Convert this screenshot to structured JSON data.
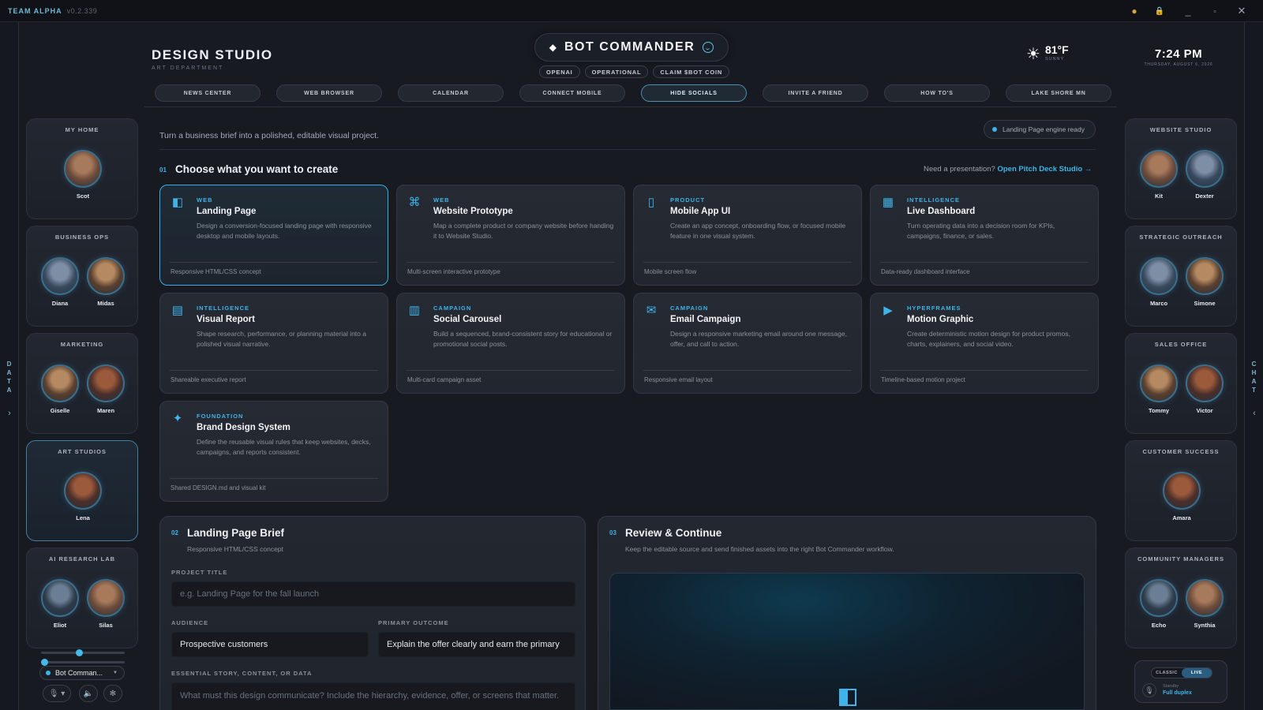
{
  "titlebar": {
    "brand": "TEAM ALPHA",
    "version": "v0.2.339"
  },
  "edges": {
    "left_label": "D\nA\nT\nA",
    "right_label": "C\nH\nA\nT",
    "left_arrow": "›",
    "right_arrow": "‹"
  },
  "header": {
    "title": "DESIGN STUDIO",
    "subtitle": "ART DEPARTMENT",
    "app_name": "BOT COMMANDER",
    "pills": [
      "OPENAI",
      "OPERATIONAL",
      "CLAIM $BOT COIN"
    ],
    "temperature": "81°F",
    "condition": "SUNNY",
    "time": "7:24 PM",
    "date": "THURSDAY, AUGUST 6, 2026"
  },
  "nav": [
    "NEWS CENTER",
    "WEB BROWSER",
    "CALENDAR",
    "CONNECT MOBILE",
    "HIDE SOCIALS",
    "INVITE A FRIEND",
    "HOW TO'S",
    "LAKE SHORE MN"
  ],
  "nav_active": "HIDE SOCIALS",
  "left_teams": [
    {
      "title": "MY HOME",
      "members": [
        "Scot"
      ]
    },
    {
      "title": "BUSINESS OPS",
      "members": [
        "Diana",
        "Midas"
      ]
    },
    {
      "title": "MARKETING",
      "members": [
        "Giselle",
        "Maren"
      ]
    },
    {
      "title": "ART STUDIOS",
      "members": [
        "Lena"
      ]
    },
    {
      "title": "AI RESEARCH LAB",
      "members": [
        "Eliot",
        "Silas"
      ]
    }
  ],
  "right_teams": [
    {
      "title": "WEBSITE STUDIO",
      "members": [
        "Kit",
        "Dexter"
      ]
    },
    {
      "title": "STRATEGIC OUTREACH",
      "members": [
        "Marco",
        "Simone"
      ]
    },
    {
      "title": "SALES OFFICE",
      "members": [
        "Tommy",
        "Victor"
      ]
    },
    {
      "title": "CUSTOMER SUCCESS",
      "members": [
        "Amara"
      ]
    },
    {
      "title": "COMMUNITY MANAGERS",
      "members": [
        "Echo",
        "Synthia"
      ]
    }
  ],
  "bot_selector": "Bot Comman...",
  "main": {
    "tagline": "Turn a business brief into a polished, editable visual project.",
    "engine_status": "Landing Page engine ready",
    "step1": {
      "no": "01",
      "title": "Choose what you want to create"
    },
    "need_text": "Need a presentation?",
    "need_link": "Open Pitch Deck Studio →",
    "cards": [
      {
        "cat": "WEB",
        "title": "Landing Page",
        "desc": "Design a conversion-focused landing page with responsive desktop and mobile layouts.",
        "foot": "Responsive HTML/CSS concept",
        "icon": "◧",
        "icon_name": "layout-icon"
      },
      {
        "cat": "WEB",
        "title": "Website Prototype",
        "desc": "Map a complete product or company website before handing it to Website Studio.",
        "foot": "Multi-screen interactive prototype",
        "icon": "⌘",
        "icon_name": "command-icon"
      },
      {
        "cat": "PRODUCT",
        "title": "Mobile App UI",
        "desc": "Create an app concept, onboarding flow, or focused mobile feature in one visual system.",
        "foot": "Mobile screen flow",
        "icon": "▯",
        "icon_name": "phone-icon"
      },
      {
        "cat": "INTELLIGENCE",
        "title": "Live Dashboard",
        "desc": "Turn operating data into a decision room for KPIs, campaigns, finance, or sales.",
        "foot": "Data-ready dashboard interface",
        "icon": "▦",
        "icon_name": "grid-icon"
      },
      {
        "cat": "INTELLIGENCE",
        "title": "Visual Report",
        "desc": "Shape research, performance, or planning material into a polished visual narrative.",
        "foot": "Shareable executive report",
        "icon": "▤",
        "icon_name": "report-icon"
      },
      {
        "cat": "CAMPAIGN",
        "title": "Social Carousel",
        "desc": "Build a sequenced, brand-consistent story for educational or promotional social posts.",
        "foot": "Multi-card campaign asset",
        "icon": "▥",
        "icon_name": "carousel-icon"
      },
      {
        "cat": "CAMPAIGN",
        "title": "Email Campaign",
        "desc": "Design a responsive marketing email around one message, offer, and call to action.",
        "foot": "Responsive email layout",
        "icon": "✉",
        "icon_name": "mail-icon"
      },
      {
        "cat": "HYPERFRAMES",
        "title": "Motion Graphic",
        "desc": "Create deterministic motion design for product promos, charts, explainers, and social video.",
        "foot": "Timeline-based motion project",
        "icon": "▶",
        "icon_name": "play-icon"
      },
      {
        "cat": "FOUNDATION",
        "title": "Brand Design System",
        "desc": "Define the reusable visual rules that keep websites, decks, campaigns, and reports consistent.",
        "foot": "Shared DESIGN.md and visual kit",
        "icon": "✦",
        "icon_name": "sparkle-icon"
      }
    ],
    "brief": {
      "no": "02",
      "title": "Landing Page Brief",
      "subtitle": "Responsive HTML/CSS concept",
      "project_title_label": "PROJECT TITLE",
      "project_title_ph": "e.g. Landing Page for the fall launch",
      "audience_label": "AUDIENCE",
      "audience_value": "Prospective customers",
      "outcome_label": "PRIMARY OUTCOME",
      "outcome_value": "Explain the offer clearly and earn the primary",
      "story_label": "ESSENTIAL STORY, CONTENT, OR DATA",
      "story_ph": "What must this design communicate? Include the hierarchy, evidence, offer, or screens that matter."
    },
    "review": {
      "no": "03",
      "title": "Review & Continue",
      "subtitle": "Keep the editable source and send finished assets into the right Bot Commander workflow."
    }
  },
  "voice": {
    "classic": "CLASSIC",
    "live": "LIVE",
    "standby": "Standby",
    "mode": "Full duplex"
  },
  "colors": {
    "accent": "#3fb4ea",
    "bg": "#171a21",
    "card": "#262a33"
  }
}
